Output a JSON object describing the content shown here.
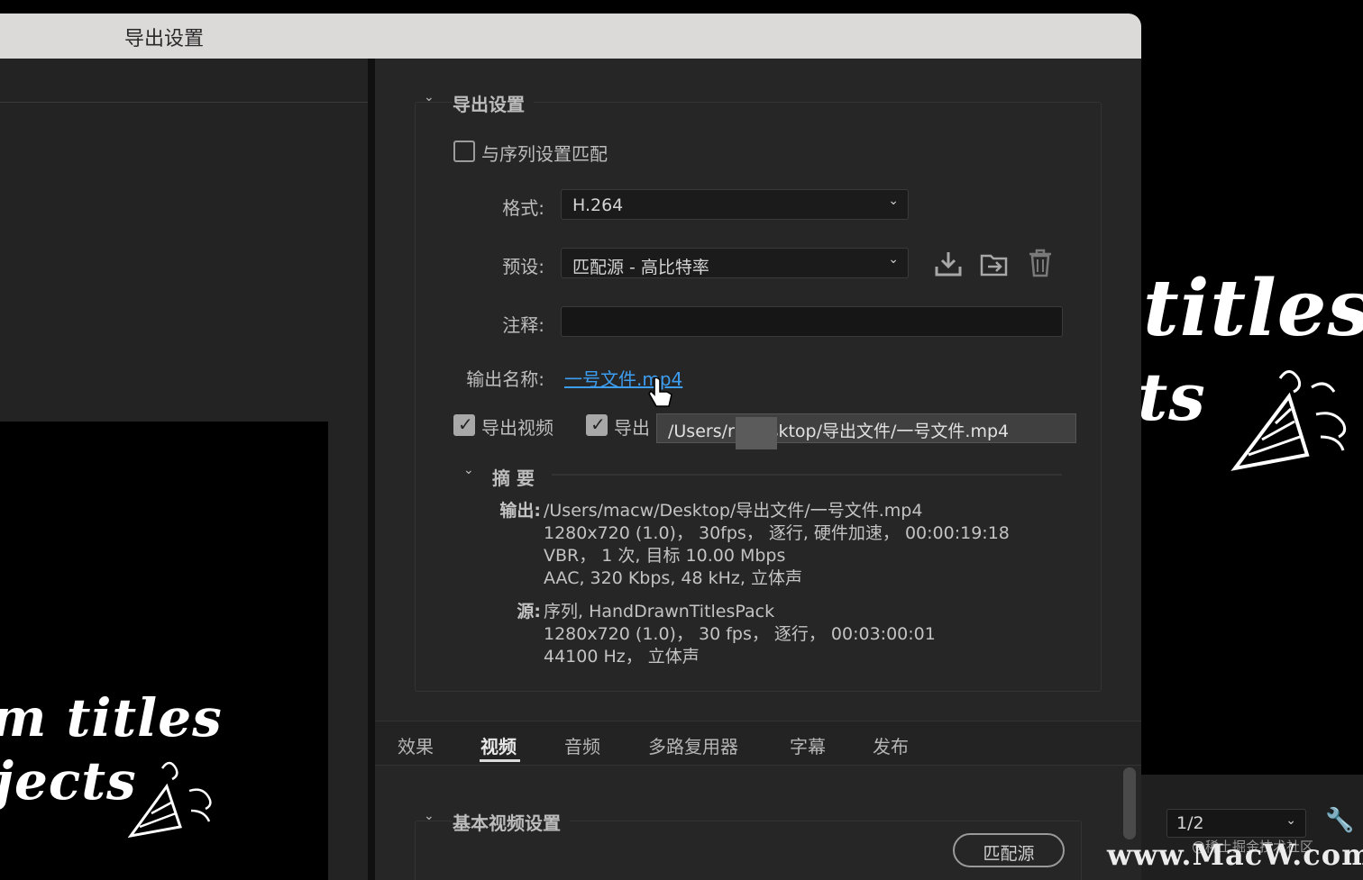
{
  "window": {
    "title": "导出设置"
  },
  "export_settings": {
    "section_title": "导出设置",
    "match_sequence_label": "与序列设置匹配",
    "format": {
      "label": "格式:",
      "value": "H.264"
    },
    "preset": {
      "label": "预设:",
      "value": "匹配源 - 高比特率"
    },
    "comment": {
      "label": "注释:",
      "value": ""
    },
    "output_name": {
      "label": "输出名称:",
      "value": "一号文件.mp4"
    },
    "export_video_label": "导出视频",
    "export_audio_label": "导出",
    "tooltip": "/Users/r       /Desktop/导出文件/一号文件.mp4",
    "preset_icons": [
      "save-preset-icon",
      "import-preset-icon",
      "delete-preset-icon"
    ]
  },
  "summary": {
    "title": "摘 要",
    "output_key": "输出:",
    "output_lines": [
      "/Users/macw/Desktop/导出文件/一号文件.mp4",
      "1280x720 (1.0)，  30fps，  逐行, 硬件加速，  00:00:19:18",
      "VBR，  1 次, 目标 10.00 Mbps",
      "AAC, 320 Kbps, 48  kHz, 立体声"
    ],
    "source_key": "源:",
    "source_lines": [
      "序列, HandDrawnTitlesPack",
      "1280x720 (1.0)，  30 fps，  逐行，  00:03:00:01",
      "44100 Hz，  立体声"
    ]
  },
  "tabs": [
    "效果",
    "视频",
    "音频",
    "多路复用器",
    "字幕",
    "发布"
  ],
  "active_tab": "视频",
  "video_section": {
    "title": "基本视频设置",
    "match_source_button": "匹配源"
  },
  "preview_overlay": {
    "line1": "m titles",
    "line2": "jects",
    "right1": "titles",
    "right2": "ts"
  },
  "page_selector": {
    "value": "1/2"
  },
  "watermark": {
    "main": "www.MacW.com",
    "sub": "@稀土掘金技术社区"
  }
}
